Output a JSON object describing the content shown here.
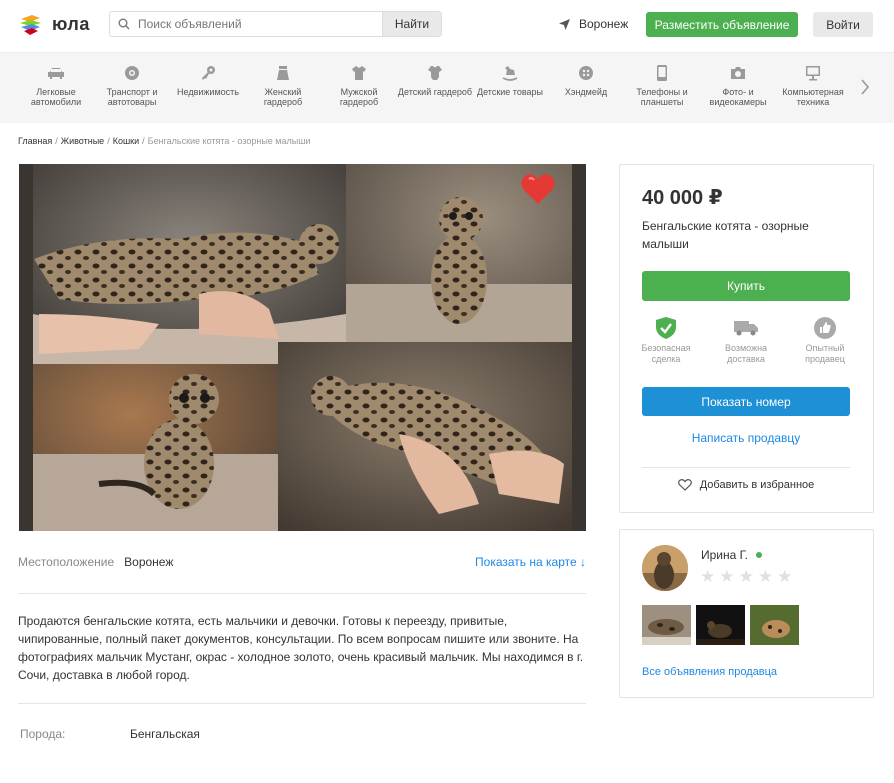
{
  "header": {
    "logo_text": "юла",
    "search_placeholder": "Поиск объявлений",
    "search_button": "Найти",
    "city": "Воронеж",
    "post_button": "Разместить объявление",
    "login_button": "Войти"
  },
  "categories": [
    {
      "label": "Легковые автомобили",
      "icon": "car-icon"
    },
    {
      "label": "Транспорт и автотовары",
      "icon": "wheel-icon"
    },
    {
      "label": "Недвижимость",
      "icon": "key-icon"
    },
    {
      "label": "Женский гардероб",
      "icon": "skirt-icon"
    },
    {
      "label": "Мужской гардероб",
      "icon": "shirt-icon"
    },
    {
      "label": "Детский гардероб",
      "icon": "bodysuit-icon"
    },
    {
      "label": "Детские товары",
      "icon": "rocking-horse-icon"
    },
    {
      "label": "Хэндмейд",
      "icon": "button-icon"
    },
    {
      "label": "Телефоны и планшеты",
      "icon": "phone-icon"
    },
    {
      "label": "Фото- и видеокамеры",
      "icon": "camera-icon"
    },
    {
      "label": "Компьютерная техника",
      "icon": "monitor-icon"
    }
  ],
  "breadcrumbs": {
    "home": "Главная",
    "animals": "Животные",
    "cats": "Кошки",
    "current": "Бенгальские котята - озорные малыши"
  },
  "listing": {
    "location_label": "Местоположение",
    "location_value": "Воронеж",
    "show_on_map": "Показать на карте ↓",
    "description": "Продаются бенгальские котята, есть мальчики и девочки. Готовы к переезду, привитые, чипированные, полный пакет документов, консультации. По всем вопросам пишите или звоните. На фотографиях мальчик Мустанг, окрас - холодное золото, очень красивый мальчик. Мы находимся в г. Сочи, доставка в любой город.",
    "breed_label": "Порода:",
    "breed_value": "Бенгальская"
  },
  "card": {
    "price": "40 000 ₽",
    "title": "Бенгальские котята - озорные малыши",
    "buy_button": "Купить",
    "features": [
      {
        "label": "Безопасная сделка",
        "icon": "shield-check-icon"
      },
      {
        "label": "Возможна доставка",
        "icon": "truck-icon"
      },
      {
        "label": "Опытный продавец",
        "icon": "thumbs-up-icon"
      }
    ],
    "show_phone": "Показать номер",
    "write_seller": "Написать продавцу",
    "add_favorite": "Добавить в избранное"
  },
  "seller": {
    "name": "Ирина Г.",
    "rating": 0,
    "all_ads": "Все объявления продавца"
  },
  "colors": {
    "green": "#4caf50",
    "blue": "#1e90d6",
    "link": "#1e88e5",
    "heart": "#e53935"
  }
}
